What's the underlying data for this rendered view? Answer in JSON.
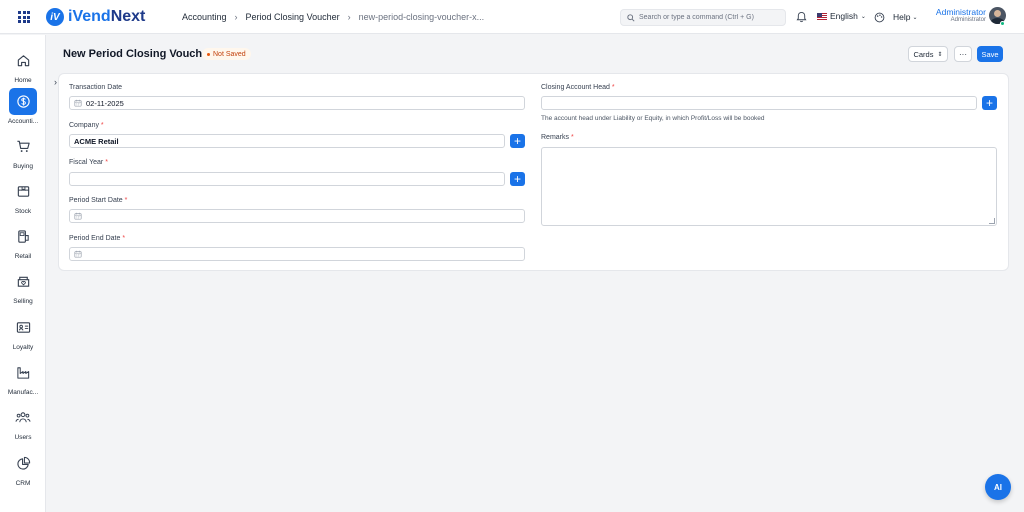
{
  "app": {
    "logo_text_a": "iVend",
    "logo_text_b": "Next",
    "logo_mark": "iV"
  },
  "breadcrumb": [
    "Accounting",
    "Period Closing Voucher",
    "new-period-closing-voucher-x..."
  ],
  "search": {
    "placeholder": "Search or type a command (Ctrl + G)"
  },
  "header": {
    "language": "English",
    "help": "Help",
    "user_name": "Administrator",
    "user_role": "Administrator"
  },
  "sidebar": {
    "items": [
      {
        "label": "Home",
        "icon": "home-icon"
      },
      {
        "label": "Accounti...",
        "icon": "dollar-icon",
        "active": true
      },
      {
        "label": "Buying",
        "icon": "cart-icon"
      },
      {
        "label": "Stock",
        "icon": "box-icon"
      },
      {
        "label": "Retail",
        "icon": "pos-icon"
      },
      {
        "label": "Selling",
        "icon": "shop-icon"
      },
      {
        "label": "Loyalty",
        "icon": "id-card-icon"
      },
      {
        "label": "Manufac...",
        "icon": "factory-icon"
      },
      {
        "label": "Users",
        "icon": "users-icon"
      },
      {
        "label": "CRM",
        "icon": "pie-icon"
      }
    ]
  },
  "page": {
    "title": "New Period Closing Voucher",
    "status": "Not Saved",
    "view_label": "Cards",
    "more_label": "···",
    "save_label": "Save"
  },
  "form": {
    "transaction_date": {
      "label": "Transaction Date",
      "value": "02-11-2025"
    },
    "company": {
      "label": "Company",
      "value": "ACME Retail"
    },
    "fiscal_year": {
      "label": "Fiscal Year",
      "value": ""
    },
    "period_start_date": {
      "label": "Period Start Date",
      "value": ""
    },
    "period_end_date": {
      "label": "Period End Date",
      "value": ""
    },
    "closing_account_head": {
      "label": "Closing Account Head",
      "value": "",
      "hint": "The account head under Liability or Equity, in which Profit/Loss will be booked"
    },
    "remarks": {
      "label": "Remarks",
      "value": ""
    }
  },
  "ai_button": "AI",
  "colors": {
    "accent": "#1a73e8",
    "brand_dark": "#1e3a8a",
    "status": "#ea580c",
    "required": "#ef4444"
  }
}
